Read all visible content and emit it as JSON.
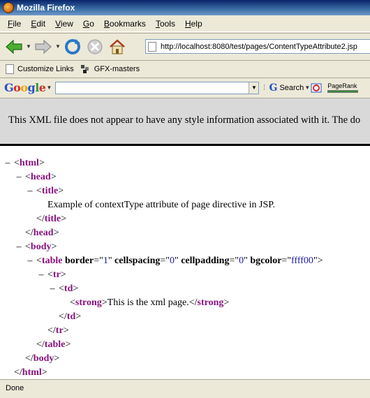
{
  "window": {
    "title": "Mozilla Firefox"
  },
  "menu": [
    {
      "label": "File",
      "accel": "F",
      "rest": "ile"
    },
    {
      "label": "Edit",
      "accel": "E",
      "rest": "dit"
    },
    {
      "label": "View",
      "accel": "V",
      "rest": "iew"
    },
    {
      "label": "Go",
      "accel": "G",
      "rest": "o"
    },
    {
      "label": "Bookmarks",
      "accel": "B",
      "rest": "ookmarks"
    },
    {
      "label": "Tools",
      "accel": "T",
      "rest": "ools"
    },
    {
      "label": "Help",
      "accel": "H",
      "rest": "elp"
    }
  ],
  "nav": {
    "url": "http://localhost:8080/test/pages/ContentTypeAttribute2.jsp",
    "icons": [
      "back-arrow-icon",
      "forward-arrow-icon",
      "reload-icon",
      "stop-icon",
      "home-icon"
    ]
  },
  "bookmarks": [
    {
      "label": "Customize Links",
      "icon": "page-icon"
    },
    {
      "label": "GFX-masters",
      "icon": "gfx-icon"
    }
  ],
  "google_toolbar": {
    "logo": "Google",
    "search_value": "",
    "search_button": "Search",
    "pagerank_label": "PageRank"
  },
  "banner": {
    "text": "This XML file does not appear to have any style information associated with it. The do"
  },
  "xml": {
    "html_open": "html",
    "head_open": "head",
    "title_open": "title",
    "title_text": "Example of contextType attribute of page directive in JSP.",
    "title_close": "title",
    "head_close": "head",
    "body_open": "body",
    "table_tag": "table",
    "attr_border": "border",
    "val_border": "1",
    "attr_cellspacing": "cellspacing",
    "val_cellspacing": "0",
    "attr_cellpadding": "cellpadding",
    "val_cellpadding": "0",
    "attr_bgcolor": "bgcolor",
    "val_bgcolor": "ffff00",
    "tr_open": "tr",
    "td_open": "td",
    "strong_tag": "strong",
    "strong_text": "This is the xml page.",
    "td_close": "td",
    "tr_close": "tr",
    "table_close": "table",
    "body_close": "body",
    "html_close": "html",
    "collapse_glyph": "–"
  },
  "status": {
    "text": "Done"
  }
}
